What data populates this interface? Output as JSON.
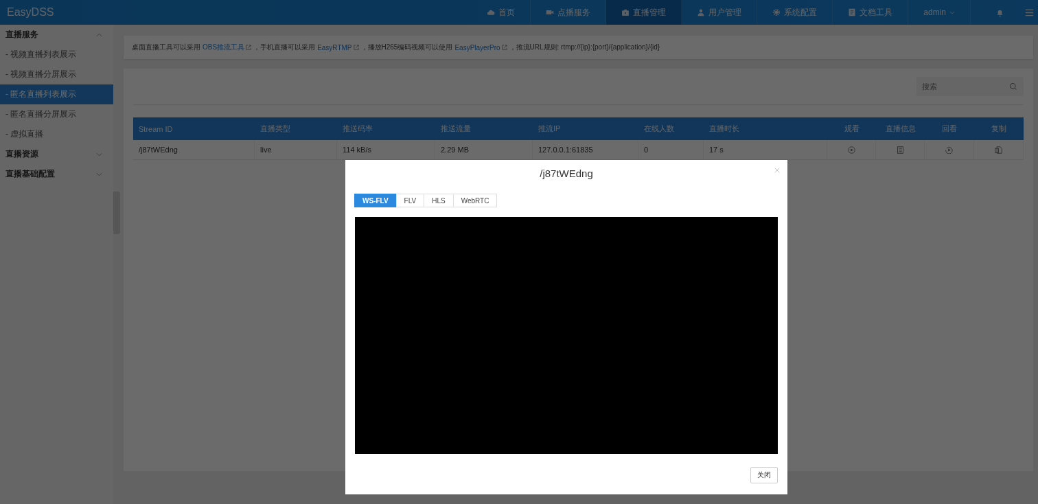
{
  "header": {
    "logo": "EasyDSS",
    "nav": [
      {
        "label": "首页",
        "selected": false
      },
      {
        "label": "点播服务",
        "selected": false
      },
      {
        "label": "直播管理",
        "selected": true
      },
      {
        "label": "用户管理",
        "selected": false
      },
      {
        "label": "系统配置",
        "selected": false
      },
      {
        "label": "文档工具",
        "selected": false
      }
    ],
    "user": "admin"
  },
  "sidebar": [
    {
      "label": "直播服务",
      "expanded": true,
      "children": [
        {
          "label": "- 视频直播列表展示",
          "selected": false
        },
        {
          "label": "- 视频直播分屏展示",
          "selected": false
        },
        {
          "label": "- 匿名直播列表展示",
          "selected": true
        },
        {
          "label": "- 匿名直播分屏展示",
          "selected": false
        },
        {
          "label": "- 虚拟直播",
          "selected": false
        }
      ]
    },
    {
      "label": "直播资源",
      "expanded": false
    },
    {
      "label": "直播基础配置",
      "expanded": false
    }
  ],
  "notice": [
    {
      "kind": "text",
      "text": "桌面直播工具可以采用"
    },
    {
      "kind": "link",
      "text": "OBS推流工具"
    },
    {
      "kind": "text",
      "text": "，手机直播可以采用"
    },
    {
      "kind": "link",
      "text": "EasyRTMP"
    },
    {
      "kind": "text",
      "text": "，播放H265编码视频可以使用"
    },
    {
      "kind": "link",
      "text": "EasyPlayerPro"
    },
    {
      "kind": "text",
      "text": "，推流URL规则: rtmp://{ip}:{port}/{application}/{id}"
    }
  ],
  "search": {
    "placeholder": "搜索"
  },
  "table": {
    "columns": [
      "Stream ID",
      "直播类型",
      "推送码率",
      "推送流量",
      "推流IP",
      "在线人数",
      "直播时长",
      "观看",
      "直播信息",
      "回看",
      "复制"
    ],
    "rows": [
      {
        "cells": [
          "/j87tWEdng",
          "live",
          "114 kB/s",
          "2.29 MB",
          "127.0.0.1:61835",
          "0",
          "17 s"
        ]
      }
    ]
  },
  "modal": {
    "title": "/j87tWEdng",
    "tabs": [
      {
        "label": "WS-FLV",
        "selected": true
      },
      {
        "label": "FLV",
        "selected": false
      },
      {
        "label": "HLS",
        "selected": false
      },
      {
        "label": "WebRTC",
        "selected": false
      }
    ],
    "close_button": "关闭"
  }
}
